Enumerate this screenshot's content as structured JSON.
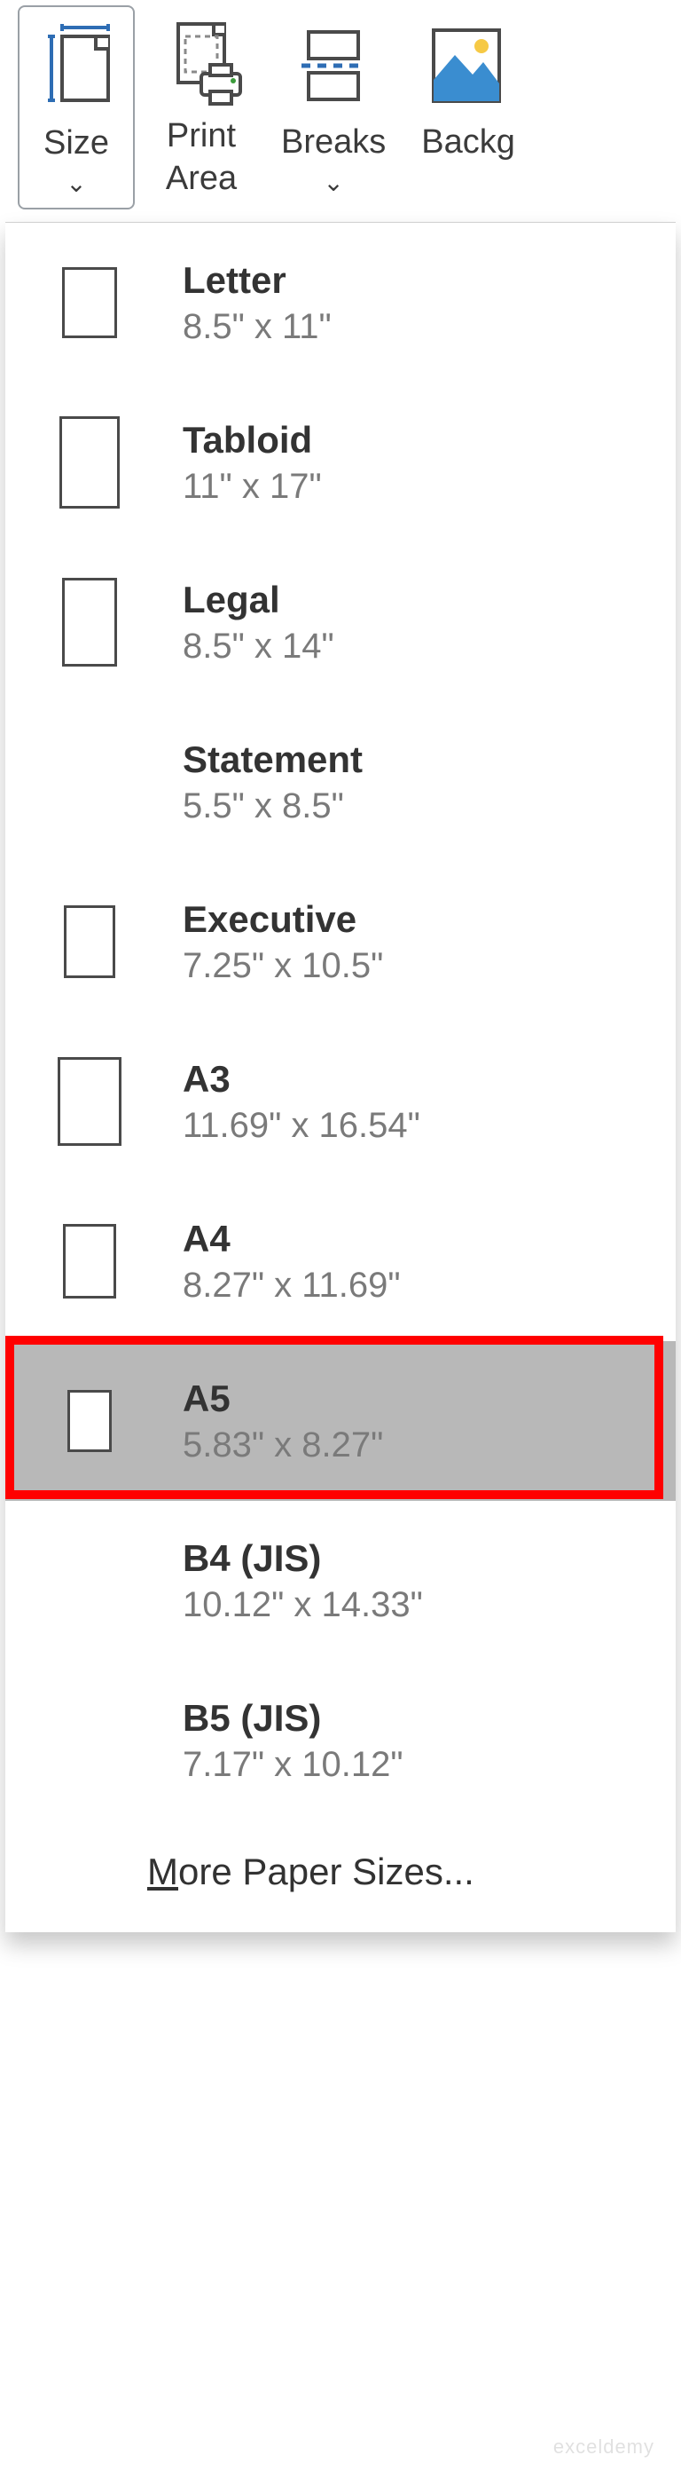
{
  "ribbon": {
    "size": {
      "label": "Size"
    },
    "print_area": {
      "label": "Print\nArea"
    },
    "breaks": {
      "label": "Breaks"
    },
    "background": {
      "label": "Backg"
    }
  },
  "sizes": [
    {
      "name": "Letter",
      "dims": "8.5\" x 11\"",
      "w": 62,
      "h": 80,
      "show_thumb": true,
      "selected": false
    },
    {
      "name": "Tabloid",
      "dims": "11\" x 17\"",
      "w": 68,
      "h": 104,
      "show_thumb": true,
      "selected": false
    },
    {
      "name": "Legal",
      "dims": "8.5\" x 14\"",
      "w": 62,
      "h": 100,
      "show_thumb": true,
      "selected": false
    },
    {
      "name": "Statement",
      "dims": "5.5\" x 8.5\"",
      "w": 46,
      "h": 68,
      "show_thumb": false,
      "selected": false
    },
    {
      "name": "Executive",
      "dims": "7.25\" x 10.5\"",
      "w": 58,
      "h": 82,
      "show_thumb": true,
      "selected": false
    },
    {
      "name": "A3",
      "dims": "11.69\" x 16.54\"",
      "w": 72,
      "h": 100,
      "show_thumb": true,
      "selected": false
    },
    {
      "name": "A4",
      "dims": "8.27\" x 11.69\"",
      "w": 60,
      "h": 84,
      "show_thumb": true,
      "selected": false
    },
    {
      "name": "A5",
      "dims": "5.83\" x 8.27\"",
      "w": 50,
      "h": 70,
      "show_thumb": true,
      "selected": true
    },
    {
      "name": "B4 (JIS)",
      "dims": "10.12\" x 14.33\"",
      "w": 66,
      "h": 92,
      "show_thumb": false,
      "selected": false
    },
    {
      "name": "B5 (JIS)",
      "dims": "7.17\" x 10.12\"",
      "w": 56,
      "h": 78,
      "show_thumb": false,
      "selected": false
    }
  ],
  "more_label_pre": "M",
  "more_label_rest": "ore Paper Sizes...",
  "watermark": "exceldemy"
}
